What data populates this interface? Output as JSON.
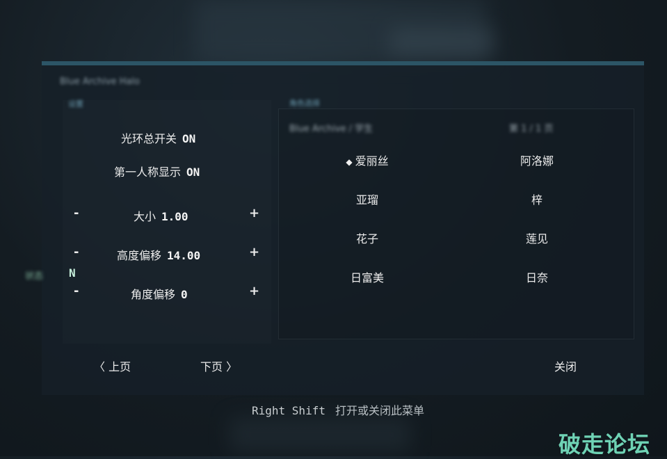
{
  "panel": {
    "title": "Blue Archive Halo",
    "left_tag": "设置",
    "right_tag": "角色选择",
    "right_head_left": "Blue Archive / 学生",
    "right_head_right": "第 1 / 1 页"
  },
  "settings": {
    "halo_master": {
      "label": "光环总开关",
      "value": "ON"
    },
    "first_person": {
      "label": "第一人称显示",
      "value": "ON"
    },
    "size": {
      "label": "大小",
      "value": "1.00"
    },
    "height_offset": {
      "label": "高度偏移",
      "value": "14.00"
    },
    "angle_offset": {
      "label": "角度偏移",
      "value": "0"
    },
    "minus": "-",
    "plus": "+"
  },
  "characters": [
    {
      "name": "爱丽丝",
      "marker": "◆"
    },
    {
      "name": "阿洛娜"
    },
    {
      "name": "亚瑠"
    },
    {
      "name": "梓"
    },
    {
      "name": "花子"
    },
    {
      "name": "莲见"
    },
    {
      "name": "日富美"
    },
    {
      "name": "日奈"
    }
  ],
  "footer": {
    "blur_label": "状态",
    "n_letter": "N",
    "prev_page": "〈 上页",
    "next_page": "下页 〉",
    "close": "关闭"
  },
  "hint": {
    "key": "Right Shift",
    "text": "打开或关闭此菜单"
  },
  "watermark": "破走论坛"
}
